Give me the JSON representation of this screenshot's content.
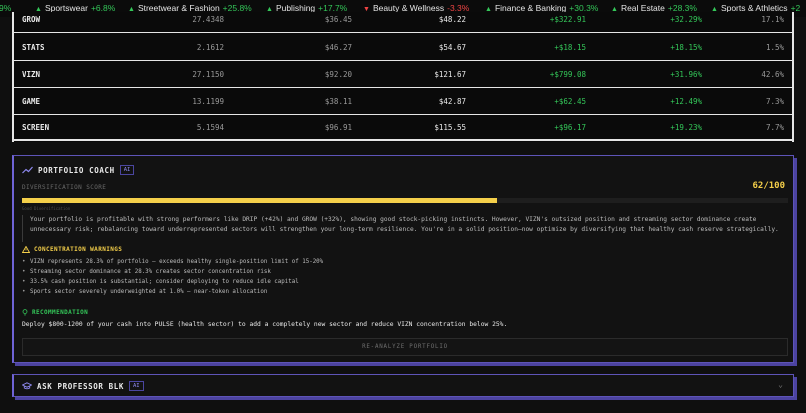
{
  "ticker": [
    {
      "name": "",
      "change": "9%",
      "dir": "up"
    },
    {
      "name": "Sportswear",
      "change": "+6.8%",
      "dir": "up"
    },
    {
      "name": "Streetwear & Fashion",
      "change": "+25.8%",
      "dir": "up"
    },
    {
      "name": "Publishing",
      "change": "+17.7%",
      "dir": "up"
    },
    {
      "name": "Beauty & Wellness",
      "change": "-3.3%",
      "dir": "down"
    },
    {
      "name": "Finance & Banking",
      "change": "+30.3%",
      "dir": "up"
    },
    {
      "name": "Real Estate",
      "change": "+28.3%",
      "dir": "up"
    },
    {
      "name": "Sports & Athletics",
      "change": "+2",
      "dir": "up"
    }
  ],
  "holdings": [
    {
      "symbol": "GROW",
      "shares": "27.4348",
      "avg": "$36.45",
      "current": "$48.22",
      "gain": "+$322.91",
      "pct": "+32.29%",
      "alloc": "17.1%"
    },
    {
      "symbol": "STATS",
      "shares": "2.1612",
      "avg": "$46.27",
      "current": "$54.67",
      "gain": "+$18.15",
      "pct": "+18.15%",
      "alloc": "1.5%"
    },
    {
      "symbol": "VIZN",
      "shares": "27.1150",
      "avg": "$92.20",
      "current": "$121.67",
      "gain": "+$799.08",
      "pct": "+31.96%",
      "alloc": "42.6%"
    },
    {
      "symbol": "GAME",
      "shares": "13.1199",
      "avg": "$38.11",
      "current": "$42.87",
      "gain": "+$62.45",
      "pct": "+12.49%",
      "alloc": "7.3%"
    },
    {
      "symbol": "SCREEN",
      "shares": "5.1594",
      "avg": "$96.91",
      "current": "$115.55",
      "gain": "+$96.17",
      "pct": "+19.23%",
      "alloc": "7.7%"
    }
  ],
  "coach": {
    "title": "PORTFOLIO COACH",
    "badge": "AI",
    "score_label": "DIVERSIFICATION SCORE",
    "score": "62/100",
    "score_fraction": 0.62,
    "bar_caption": "Good Diversification",
    "summary": "Your portfolio is profitable with strong performers like DRIP (+42%) and GROW (+32%), showing good stock-picking instincts. However, VIZN's outsized position and streaming sector dominance create unnecessary risk; rebalancing toward underrepresented sectors will strengthen your long-term resilience. You're in a solid position—now optimize by diversifying that healthy cash reserve strategically.",
    "warnings_title": "CONCENTRATION WARNINGS",
    "warnings": [
      "VIZN represents 28.3% of portfolio — exceeds healthy single-position limit of 15-20%",
      "Streaming sector dominance at 28.3% creates sector concentration risk",
      "33.5% cash position is substantial; consider deploying to reduce idle capital",
      "Sports sector severely underweighted at 1.0% — near-token allocation"
    ],
    "rec_title": "RECOMMENDATION",
    "rec_text": "Deploy $800-1200 of your cash into PULSE (health sector) to add a completely new sector and reduce VIZN concentration below 25%.",
    "reanalyze_label": "RE-ANALYZE PORTFOLIO"
  },
  "ask": {
    "title": "ASK PROFESSOR BLK",
    "badge": "AI"
  },
  "colors": {
    "accent": "#6f63d6",
    "gain": "#34c759",
    "loss": "#ef4444",
    "score": "#f4cf4a"
  }
}
